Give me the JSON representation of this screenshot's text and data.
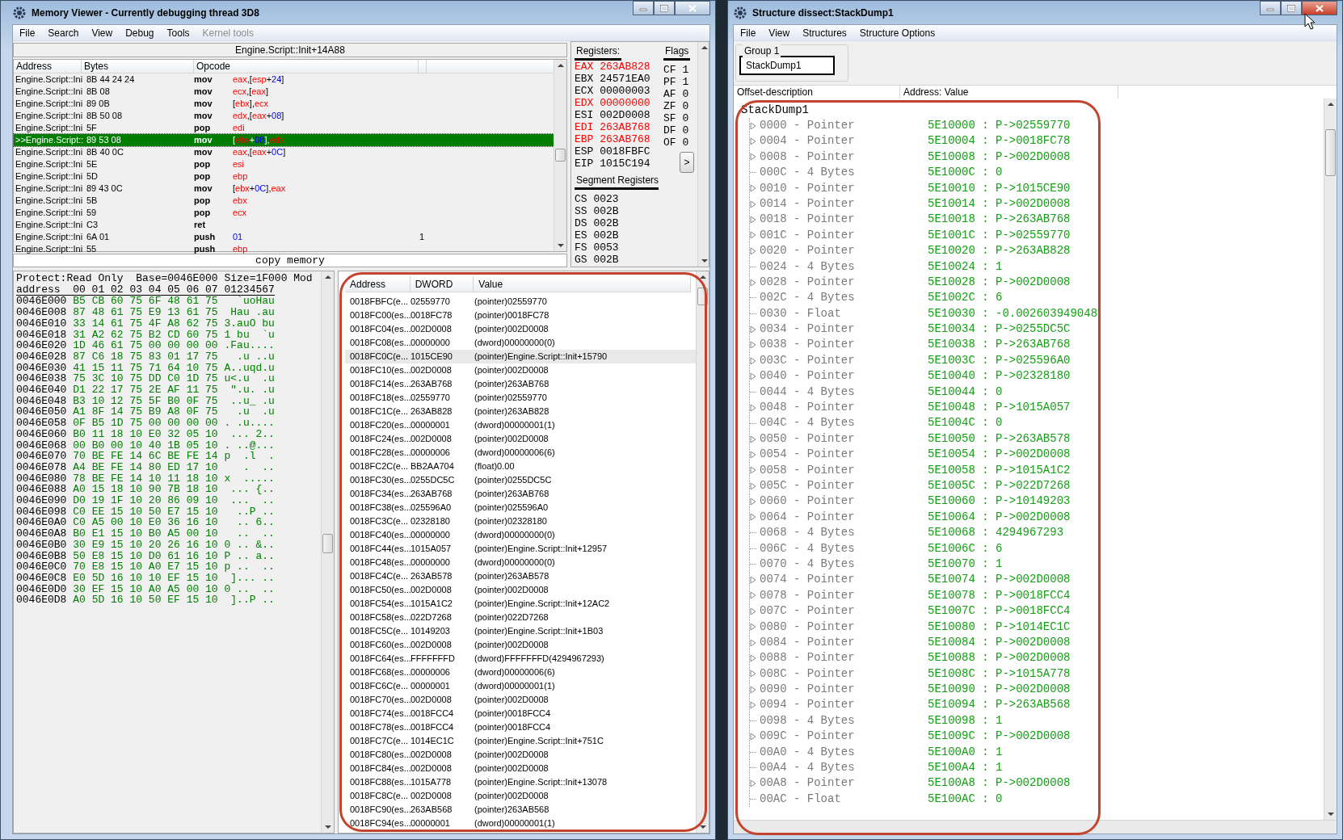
{
  "memory_viewer": {
    "title": "Memory Viewer - Currently debugging thread 3D8",
    "menu": [
      {
        "label": "File",
        "disabled": false
      },
      {
        "label": "Search",
        "disabled": false
      },
      {
        "label": "View",
        "disabled": false
      },
      {
        "label": "Debug",
        "disabled": false
      },
      {
        "label": "Tools",
        "disabled": false
      },
      {
        "label": "Kernel tools",
        "disabled": true
      }
    ],
    "disassembler": {
      "location": "Engine.Script::Init+14A88",
      "columns": [
        "Address",
        "Bytes",
        "Opcode"
      ],
      "rows": [
        {
          "address": "Engine.Script::Ini",
          "bytes": "8B 44 24 24",
          "opcode": "mov",
          "operands": "eax,[esp+24]",
          "selected": false
        },
        {
          "address": "Engine.Script::Ini",
          "bytes": "8B 08",
          "opcode": "mov",
          "operands": "ecx,[eax]",
          "selected": false
        },
        {
          "address": "Engine.Script::Ini",
          "bytes": "89 0B",
          "opcode": "mov",
          "operands": "[ebx],ecx",
          "selected": false
        },
        {
          "address": "Engine.Script::Ini",
          "bytes": "8B 50 08",
          "opcode": "mov",
          "operands": "edx,[eax+08]",
          "selected": false
        },
        {
          "address": "Engine.Script::Ini",
          "bytes": "5F",
          "opcode": "pop",
          "operands": "edi",
          "selected": false
        },
        {
          "address": ">>Engine.Script::",
          "bytes": "89 53 08",
          "opcode": "mov",
          "operands": "[ebx+08],edx",
          "selected": true
        },
        {
          "address": "Engine.Script::Ini",
          "bytes": "8B 40 0C",
          "opcode": "mov",
          "operands": "eax,[eax+0C]",
          "selected": false
        },
        {
          "address": "Engine.Script::Ini",
          "bytes": "5E",
          "opcode": "pop",
          "operands": "esi",
          "selected": false
        },
        {
          "address": "Engine.Script::Ini",
          "bytes": "5D",
          "opcode": "pop",
          "operands": "ebp",
          "selected": false
        },
        {
          "address": "Engine.Script::Ini",
          "bytes": "89 43 0C",
          "opcode": "mov",
          "operands": "[ebx+0C],eax",
          "selected": false
        },
        {
          "address": "Engine.Script::Ini",
          "bytes": "5B",
          "opcode": "pop",
          "operands": "ebx",
          "selected": false
        },
        {
          "address": "Engine.Script::Ini",
          "bytes": "59",
          "opcode": "pop",
          "operands": "ecx",
          "selected": false
        },
        {
          "address": "Engine.Script::Ini",
          "bytes": "C3",
          "opcode": "ret",
          "selected": false
        },
        {
          "address": "Engine.Script::Ini",
          "bytes": "6A 01",
          "opcode": "push",
          "operands": "01",
          "comment": "1",
          "selected": false
        },
        {
          "address": "Engine.Script::Ini",
          "bytes": "55",
          "opcode": "push",
          "operands": "ebp",
          "selected": false
        }
      ]
    },
    "status": "copy memory",
    "registers": {
      "label": "Registers:",
      "items": [
        {
          "name": "EAX",
          "value": "263AB828",
          "changed": true
        },
        {
          "name": "EBX",
          "value": "24571EA0",
          "changed": false
        },
        {
          "name": "ECX",
          "value": "00000003",
          "changed": false
        },
        {
          "name": "EDX",
          "value": "00000000",
          "changed": true
        },
        {
          "name": "ESI",
          "value": "002D0008",
          "changed": false
        },
        {
          "name": "EDI",
          "value": "263AB768",
          "changed": true
        },
        {
          "name": "EBP",
          "value": "263AB768",
          "changed": true
        },
        {
          "name": "ESP",
          "value": "0018FBFC",
          "changed": false
        },
        {
          "name": "EIP",
          "value": "1015C194",
          "changed": false
        }
      ],
      "flags_label": "Flags",
      "flags": [
        {
          "name": "CF",
          "value": "1"
        },
        {
          "name": "PF",
          "value": "1"
        },
        {
          "name": "AF",
          "value": "0"
        },
        {
          "name": "ZF",
          "value": "0"
        },
        {
          "name": "SF",
          "value": "0"
        },
        {
          "name": "DF",
          "value": "0"
        },
        {
          "name": "OF",
          "value": "0"
        }
      ],
      "more_button": ">",
      "segment_label": "Segment Registers",
      "segments": [
        {
          "name": "CS",
          "value": "0023"
        },
        {
          "name": "SS",
          "value": "002B"
        },
        {
          "name": "DS",
          "value": "002B"
        },
        {
          "name": "ES",
          "value": "002B"
        },
        {
          "name": "FS",
          "value": "0053"
        },
        {
          "name": "GS",
          "value": "002B"
        }
      ]
    },
    "hex_view": {
      "info": "Protect:Read Only  Base=0046E000 Size=1F000 Mod",
      "header": "address  00 01 02 03 04 05 06 07 01234567",
      "rows": [
        {
          "address": "0046E000",
          "bytes": "B5 CB 60 75 6F 48 61 75",
          "ascii": "  `uoHau"
        },
        {
          "address": "0046E008",
          "bytes": "87 48 61 75 E9 13 61 75",
          "ascii": " Hau .au"
        },
        {
          "address": "0046E010",
          "bytes": "33 14 61 75 4F A8 62 75",
          "ascii": "3.auO bu"
        },
        {
          "address": "0046E018",
          "bytes": "31 A2 62 75 B2 CD 60 75",
          "ascii": "1 bu  `u"
        },
        {
          "address": "0046E020",
          "bytes": "1D 46 61 75 00 00 00 00",
          "ascii": ".Fau...."
        },
        {
          "address": "0046E028",
          "bytes": "87 C6 18 75 83 01 17 75",
          "ascii": "  .u ..u"
        },
        {
          "address": "0046E030",
          "bytes": "41 15 11 75 71 64 10 75",
          "ascii": "A..uqd.u"
        },
        {
          "address": "0046E038",
          "bytes": "75 3C 10 75 DD C0 1D 75",
          "ascii": "u<.u  .u"
        },
        {
          "address": "0046E040",
          "bytes": "D1 22 17 75 2E AF 11 75",
          "ascii": " \".u. .u"
        },
        {
          "address": "0046E048",
          "bytes": "B3 10 12 75 5F B0 0F 75",
          "ascii": " ..u_ .u"
        },
        {
          "address": "0046E050",
          "bytes": "A1 8F 14 75 B9 A8 0F 75",
          "ascii": "  .u  .u"
        },
        {
          "address": "0046E058",
          "bytes": "0F B5 1D 75 00 00 00 00",
          "ascii": ". .u...."
        },
        {
          "address": "0046E060",
          "bytes": "B0 11 18 10 E0 32 05 10",
          "ascii": " ... 2.."
        },
        {
          "address": "0046E068",
          "bytes": "00 B0 00 10 40 1B 05 10",
          "ascii": ". ..@..."
        },
        {
          "address": "0046E070",
          "bytes": "70 BE FE 14 6C BE FE 14",
          "ascii": "p  .l  ."
        },
        {
          "address": "0046E078",
          "bytes": "A4 BE FE 14 80 ED 17 10",
          "ascii": "   .  .."
        },
        {
          "address": "0046E080",
          "bytes": "78 BE FE 14 10 11 18 10",
          "ascii": "x  ....."
        },
        {
          "address": "0046E088",
          "bytes": "A0 15 18 10 90 7B 18 10",
          "ascii": " ... {.."
        },
        {
          "address": "0046E090",
          "bytes": "D0 19 1F 10 20 86 09 10",
          "ascii": " ...  .."
        },
        {
          "address": "0046E098",
          "bytes": "C0 EE 15 10 50 E7 15 10",
          "ascii": "  ..P .."
        },
        {
          "address": "0046E0A0",
          "bytes": "C0 A5 00 10 E0 36 16 10",
          "ascii": "  .. 6.."
        },
        {
          "address": "0046E0A8",
          "bytes": "B0 E1 15 10 B0 A5 00 10",
          "ascii": "  ..  .."
        },
        {
          "address": "0046E0B0",
          "bytes": "30 E9 15 10 20 26 16 10",
          "ascii": "0 .. &.."
        },
        {
          "address": "0046E0B8",
          "bytes": "50 E8 15 10 D0 61 16 10",
          "ascii": "P .. a.."
        },
        {
          "address": "0046E0C0",
          "bytes": "70 E8 15 10 A0 E7 15 10",
          "ascii": "p ..  .."
        },
        {
          "address": "0046E0C8",
          "bytes": "E0 5D 16 10 10 EF 15 10",
          "ascii": " ]... .."
        },
        {
          "address": "0046E0D0",
          "bytes": "30 EF 15 10 A0 A5 00 10",
          "ascii": "0 ..  .."
        },
        {
          "address": "0046E0D8",
          "bytes": "A0 5D 16 10 50 EF 15 10",
          "ascii": " ]..P .."
        }
      ]
    },
    "stack": {
      "columns": [
        "Address",
        "DWORD",
        "Value"
      ],
      "rows": [
        {
          "address": "0018FBFC(e...",
          "dword": "02559770",
          "value": "(pointer)02559770",
          "selected": false
        },
        {
          "address": "0018FC00(es...",
          "dword": "0018FC78",
          "value": "(pointer)0018FC78",
          "selected": false
        },
        {
          "address": "0018FC04(es...",
          "dword": "002D0008",
          "value": "(pointer)002D0008",
          "selected": false
        },
        {
          "address": "0018FC08(es...",
          "dword": "00000000",
          "value": "(dword)00000000(0)",
          "selected": false
        },
        {
          "address": "0018FC0C(e...",
          "dword": "1015CE90",
          "value": "(pointer)Engine.Script::Init+15790",
          "selected": true
        },
        {
          "address": "0018FC10(es...",
          "dword": "002D0008",
          "value": "(pointer)002D0008",
          "selected": false
        },
        {
          "address": "0018FC14(es...",
          "dword": "263AB768",
          "value": "(pointer)263AB768",
          "selected": false
        },
        {
          "address": "0018FC18(es...",
          "dword": "02559770",
          "value": "(pointer)02559770",
          "selected": false
        },
        {
          "address": "0018FC1C(e...",
          "dword": "263AB828",
          "value": "(pointer)263AB828",
          "selected": false
        },
        {
          "address": "0018FC20(es...",
          "dword": "00000001",
          "value": "(dword)00000001(1)",
          "selected": false
        },
        {
          "address": "0018FC24(es...",
          "dword": "002D0008",
          "value": "(pointer)002D0008",
          "selected": false
        },
        {
          "address": "0018FC28(es...",
          "dword": "00000006",
          "value": "(dword)00000006(6)",
          "selected": false
        },
        {
          "address": "0018FC2C(e...",
          "dword": "BB2AA704",
          "value": "(float)0.00",
          "selected": false
        },
        {
          "address": "0018FC30(es...",
          "dword": "0255DC5C",
          "value": "(pointer)0255DC5C",
          "selected": false
        },
        {
          "address": "0018FC34(es...",
          "dword": "263AB768",
          "value": "(pointer)263AB768",
          "selected": false
        },
        {
          "address": "0018FC38(es...",
          "dword": "025596A0",
          "value": "(pointer)025596A0",
          "selected": false
        },
        {
          "address": "0018FC3C(e...",
          "dword": "02328180",
          "value": "(pointer)02328180",
          "selected": false
        },
        {
          "address": "0018FC40(es...",
          "dword": "00000000",
          "value": "(dword)00000000(0)",
          "selected": false
        },
        {
          "address": "0018FC44(es...",
          "dword": "1015A057",
          "value": "(pointer)Engine.Script::Init+12957",
          "selected": false
        },
        {
          "address": "0018FC48(es...",
          "dword": "00000000",
          "value": "(dword)00000000(0)",
          "selected": false
        },
        {
          "address": "0018FC4C(e...",
          "dword": "263AB578",
          "value": "(pointer)263AB578",
          "selected": false
        },
        {
          "address": "0018FC50(es...",
          "dword": "002D0008",
          "value": "(pointer)002D0008",
          "selected": false
        },
        {
          "address": "0018FC54(es...",
          "dword": "1015A1C2",
          "value": "(pointer)Engine.Script::Init+12AC2",
          "selected": false
        },
        {
          "address": "0018FC58(es...",
          "dword": "022D7268",
          "value": "(pointer)022D7268",
          "selected": false
        },
        {
          "address": "0018FC5C(e...",
          "dword": "10149203",
          "value": "(pointer)Engine.Script::Init+1B03",
          "selected": false
        },
        {
          "address": "0018FC60(es...",
          "dword": "002D0008",
          "value": "(pointer)002D0008",
          "selected": false
        },
        {
          "address": "0018FC64(es...",
          "dword": "FFFFFFFD",
          "value": "(dword)FFFFFFFD(4294967293)",
          "selected": false
        },
        {
          "address": "0018FC68(es...",
          "dword": "00000006",
          "value": "(dword)00000006(6)",
          "selected": false
        },
        {
          "address": "0018FC6C(e...",
          "dword": "00000001",
          "value": "(dword)00000001(1)",
          "selected": false
        },
        {
          "address": "0018FC70(es...",
          "dword": "002D0008",
          "value": "(pointer)002D0008",
          "selected": false
        },
        {
          "address": "0018FC74(es...",
          "dword": "0018FCC4",
          "value": "(pointer)0018FCC4",
          "selected": false
        },
        {
          "address": "0018FC78(es...",
          "dword": "0018FCC4",
          "value": "(pointer)0018FCC4",
          "selected": false
        },
        {
          "address": "0018FC7C(e...",
          "dword": "1014EC1C",
          "value": "(pointer)Engine.Script::Init+751C",
          "selected": false
        },
        {
          "address": "0018FC80(es...",
          "dword": "002D0008",
          "value": "(pointer)002D0008",
          "selected": false
        },
        {
          "address": "0018FC84(es...",
          "dword": "002D0008",
          "value": "(pointer)002D0008",
          "selected": false
        },
        {
          "address": "0018FC88(es...",
          "dword": "1015A778",
          "value": "(pointer)Engine.Script::Init+13078",
          "selected": false
        },
        {
          "address": "0018FC8C(e...",
          "dword": "002D0008",
          "value": "(pointer)002D0008",
          "selected": false
        },
        {
          "address": "0018FC90(es...",
          "dword": "263AB568",
          "value": "(pointer)263AB568",
          "selected": false
        },
        {
          "address": "0018FC94(es...",
          "dword": "00000001",
          "value": "(dword)00000001(1)",
          "selected": false
        }
      ]
    }
  },
  "structure_dissect": {
    "title": "Structure dissect:StackDump1",
    "menu": [
      "File",
      "View",
      "Structures",
      "Structure Options"
    ],
    "group": {
      "label": "Group 1",
      "field": "StackDump1"
    },
    "columns": [
      "Offset-description",
      "Address: Value"
    ],
    "root": "StackDump1",
    "children": [
      {
        "desc": "0000 - Pointer",
        "value": "5E10000 : P->02559770",
        "expandable": true
      },
      {
        "desc": "0004 - Pointer",
        "value": "5E10004 : P->0018FC78",
        "expandable": true
      },
      {
        "desc": "0008 - Pointer",
        "value": "5E10008 : P->002D0008",
        "expandable": true
      },
      {
        "desc": "000C - 4 Bytes",
        "value": "5E1000C : 0",
        "expandable": false
      },
      {
        "desc": "0010 - Pointer",
        "value": "5E10010 : P->1015CE90",
        "expandable": true
      },
      {
        "desc": "0014 - Pointer",
        "value": "5E10014 : P->002D0008",
        "expandable": true
      },
      {
        "desc": "0018 - Pointer",
        "value": "5E10018 : P->263AB768",
        "expandable": true
      },
      {
        "desc": "001C - Pointer",
        "value": "5E1001C : P->02559770",
        "expandable": true
      },
      {
        "desc": "0020 - Pointer",
        "value": "5E10020 : P->263AB828",
        "expandable": true
      },
      {
        "desc": "0024 - 4 Bytes",
        "value": "5E10024 : 1",
        "expandable": false
      },
      {
        "desc": "0028 - Pointer",
        "value": "5E10028 : P->002D0008",
        "expandable": true
      },
      {
        "desc": "002C - 4 Bytes",
        "value": "5E1002C : 6",
        "expandable": false
      },
      {
        "desc": "0030 - Float",
        "value": "5E10030 : -0.002603949048",
        "expandable": false
      },
      {
        "desc": "0034 - Pointer",
        "value": "5E10034 : P->0255DC5C",
        "expandable": true
      },
      {
        "desc": "0038 - Pointer",
        "value": "5E10038 : P->263AB768",
        "expandable": true
      },
      {
        "desc": "003C - Pointer",
        "value": "5E1003C : P->025596A0",
        "expandable": true
      },
      {
        "desc": "0040 - Pointer",
        "value": "5E10040 : P->02328180",
        "expandable": true
      },
      {
        "desc": "0044 - 4 Bytes",
        "value": "5E10044 : 0",
        "expandable": false
      },
      {
        "desc": "0048 - Pointer",
        "value": "5E10048 : P->1015A057",
        "expandable": true
      },
      {
        "desc": "004C - 4 Bytes",
        "value": "5E1004C : 0",
        "expandable": false
      },
      {
        "desc": "0050 - Pointer",
        "value": "5E10050 : P->263AB578",
        "expandable": true
      },
      {
        "desc": "0054 - Pointer",
        "value": "5E10054 : P->002D0008",
        "expandable": true
      },
      {
        "desc": "0058 - Pointer",
        "value": "5E10058 : P->1015A1C2",
        "expandable": true
      },
      {
        "desc": "005C - Pointer",
        "value": "5E1005C : P->022D7268",
        "expandable": true
      },
      {
        "desc": "0060 - Pointer",
        "value": "5E10060 : P->10149203",
        "expandable": true
      },
      {
        "desc": "0064 - Pointer",
        "value": "5E10064 : P->002D0008",
        "expandable": true
      },
      {
        "desc": "0068 - 4 Bytes",
        "value": "5E10068 : 4294967293",
        "expandable": false
      },
      {
        "desc": "006C - 4 Bytes",
        "value": "5E1006C : 6",
        "expandable": false
      },
      {
        "desc": "0070 - 4 Bytes",
        "value": "5E10070 : 1",
        "expandable": false
      },
      {
        "desc": "0074 - Pointer",
        "value": "5E10074 : P->002D0008",
        "expandable": true
      },
      {
        "desc": "0078 - Pointer",
        "value": "5E10078 : P->0018FCC4",
        "expandable": true
      },
      {
        "desc": "007C - Pointer",
        "value": "5E1007C : P->0018FCC4",
        "expandable": true
      },
      {
        "desc": "0080 - Pointer",
        "value": "5E10080 : P->1014EC1C",
        "expandable": true
      },
      {
        "desc": "0084 - Pointer",
        "value": "5E10084 : P->002D0008",
        "expandable": true
      },
      {
        "desc": "0088 - Pointer",
        "value": "5E10088 : P->002D0008",
        "expandable": true
      },
      {
        "desc": "008C - Pointer",
        "value": "5E1008C : P->1015A778",
        "expandable": true
      },
      {
        "desc": "0090 - Pointer",
        "value": "5E10090 : P->002D0008",
        "expandable": true
      },
      {
        "desc": "0094 - Pointer",
        "value": "5E10094 : P->263AB568",
        "expandable": true
      },
      {
        "desc": "0098 - 4 Bytes",
        "value": "5E10098 : 1",
        "expandable": false
      },
      {
        "desc": "009C - Pointer",
        "value": "5E1009C : P->002D0008",
        "expandable": true
      },
      {
        "desc": "00A0 - 4 Bytes",
        "value": "5E100A0 : 1",
        "expandable": false
      },
      {
        "desc": "00A4 - 4 Bytes",
        "value": "5E100A4 : 1",
        "expandable": false
      },
      {
        "desc": "00A8 - Pointer",
        "value": "5E100A8 : P->002D0008",
        "expandable": true
      },
      {
        "desc": "00AC - Float",
        "value": "5E100AC : 0",
        "expandable": false
      }
    ]
  }
}
